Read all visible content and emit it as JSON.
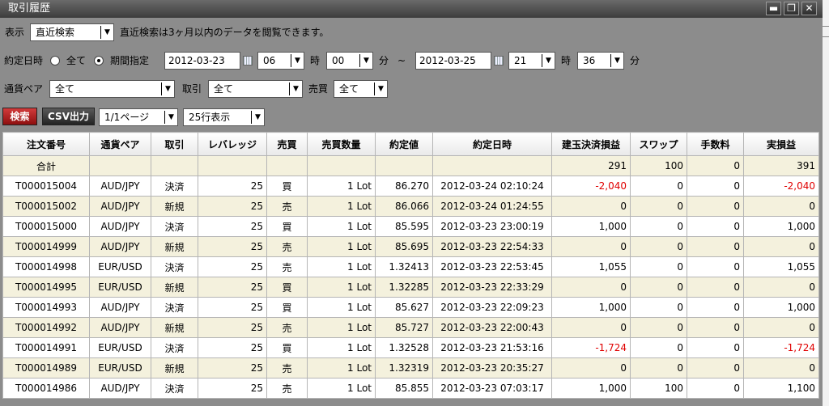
{
  "window": {
    "title": "取引履歴",
    "min_label": "▬",
    "restore_label": "❐",
    "close_label": "✕"
  },
  "filter1": {
    "display_label": "表示",
    "display_value": "直近検索",
    "note": "直近検索は3ヶ月以内のデータを閲覧できます。"
  },
  "filter2": {
    "date_label": "約定日時",
    "all_label": "全て",
    "range_label": "期間指定",
    "from_date": "2012-03-23",
    "from_hour": "06",
    "hour_unit": "時",
    "from_min": "00",
    "min_unit": "分",
    "tilde": "~",
    "to_date": "2012-03-25",
    "to_hour": "21",
    "to_min": "36"
  },
  "filter3": {
    "pair_label": "通貨ペア",
    "pair_value": "全て",
    "trade_label": "取引",
    "trade_value": "全て",
    "side_label": "売買",
    "side_value": "全て"
  },
  "toolbar": {
    "search_label": "検索",
    "csv_label": "CSV出力",
    "page_value": "1/1ページ",
    "rows_value": "25行表示"
  },
  "table": {
    "headers": [
      "注文番号",
      "通貨ペア",
      "取引",
      "レバレッジ",
      "売買",
      "売買数量",
      "約定値",
      "約定日時",
      "建玉決済損益",
      "スワップ",
      "手数料",
      "実損益"
    ],
    "total": {
      "label": "合計",
      "pl": "291",
      "swap": "100",
      "fee": "0",
      "net": "391"
    },
    "rows": [
      [
        "T000015004",
        "AUD/JPY",
        "決済",
        "25",
        "買",
        "1 Lot",
        "86.270",
        "2012-03-24 02:10:24",
        "-2,040",
        "0",
        "0",
        "-2,040"
      ],
      [
        "T000015002",
        "AUD/JPY",
        "新規",
        "25",
        "売",
        "1 Lot",
        "86.066",
        "2012-03-24 01:24:55",
        "0",
        "0",
        "0",
        "0"
      ],
      [
        "T000015000",
        "AUD/JPY",
        "決済",
        "25",
        "買",
        "1 Lot",
        "85.595",
        "2012-03-23 23:00:19",
        "1,000",
        "0",
        "0",
        "1,000"
      ],
      [
        "T000014999",
        "AUD/JPY",
        "新規",
        "25",
        "売",
        "1 Lot",
        "85.695",
        "2012-03-23 22:54:33",
        "0",
        "0",
        "0",
        "0"
      ],
      [
        "T000014998",
        "EUR/USD",
        "決済",
        "25",
        "売",
        "1 Lot",
        "1.32413",
        "2012-03-23 22:53:45",
        "1,055",
        "0",
        "0",
        "1,055"
      ],
      [
        "T000014995",
        "EUR/USD",
        "新規",
        "25",
        "買",
        "1 Lot",
        "1.32285",
        "2012-03-23 22:33:29",
        "0",
        "0",
        "0",
        "0"
      ],
      [
        "T000014993",
        "AUD/JPY",
        "決済",
        "25",
        "買",
        "1 Lot",
        "85.627",
        "2012-03-23 22:09:23",
        "1,000",
        "0",
        "0",
        "1,000"
      ],
      [
        "T000014992",
        "AUD/JPY",
        "新規",
        "25",
        "売",
        "1 Lot",
        "85.727",
        "2012-03-23 22:00:43",
        "0",
        "0",
        "0",
        "0"
      ],
      [
        "T000014991",
        "EUR/USD",
        "決済",
        "25",
        "買",
        "1 Lot",
        "1.32528",
        "2012-03-23 21:53:16",
        "-1,724",
        "0",
        "0",
        "-1,724"
      ],
      [
        "T000014989",
        "EUR/USD",
        "新規",
        "25",
        "売",
        "1 Lot",
        "1.32319",
        "2012-03-23 20:35:27",
        "0",
        "0",
        "0",
        "0"
      ],
      [
        "T000014986",
        "AUD/JPY",
        "決済",
        "25",
        "売",
        "1 Lot",
        "85.855",
        "2012-03-23 07:03:17",
        "1,000",
        "100",
        "0",
        "1,100"
      ]
    ]
  }
}
